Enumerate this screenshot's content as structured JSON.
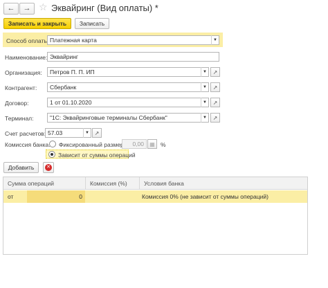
{
  "window": {
    "title": "Эквайринг (Вид оплаты) *"
  },
  "toolbar": {
    "back_icon": "arrow-left-icon",
    "forward_icon": "arrow-right-icon",
    "favorite_icon": "star-icon",
    "save_close_label": "Записать и закрыть",
    "save_label": "Записать"
  },
  "form": {
    "payment_method": {
      "label": "Способ оплаты:",
      "value": "Платежная карта"
    },
    "name": {
      "label": "Наименование:",
      "value": "Эквайринг"
    },
    "organization": {
      "label": "Организация:",
      "value": "Петров П. П. ИП"
    },
    "counterparty": {
      "label": "Контрагент:",
      "value": "Сбербанк"
    },
    "contract": {
      "label": "Договор:",
      "value": "1 от 01.10.2020"
    },
    "terminal": {
      "label": "Терминал:",
      "value": "\"1С: Эквайринговые терминалы Сбербанк\""
    },
    "account": {
      "label": "Счет расчетов:",
      "value": "57.03"
    },
    "commission": {
      "label": "Комиссия банка:",
      "option_fixed": "Фиксированный размер",
      "fixed_value": "0,00",
      "percent_sign": "%",
      "option_sum": "Зависит от суммы операций",
      "selected": "option_sum"
    }
  },
  "table_toolbar": {
    "add_label": "Добавить",
    "delete_icon": "delete-icon"
  },
  "table": {
    "columns": [
      "Сумма операций",
      "Комиссия (%)",
      "Условия банка"
    ],
    "rows": [
      {
        "from_label": "от",
        "amount": "0",
        "commission": "",
        "conditions": "Комиссия 0% (не зависит от суммы операций)"
      }
    ]
  },
  "colors": {
    "accent_yellow": "#f5cf00",
    "highlight": "#fbeea5",
    "delete_red": "#d62b2b"
  }
}
